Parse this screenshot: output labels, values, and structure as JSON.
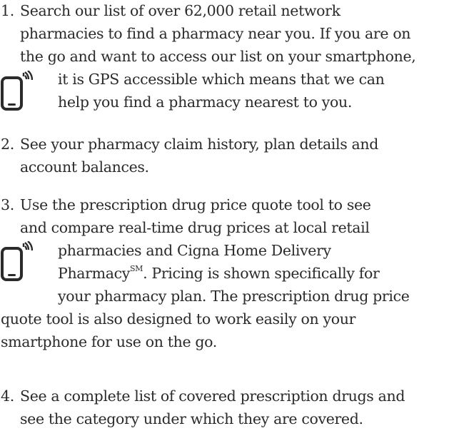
{
  "items": [
    {
      "number": "1.",
      "lines": [
        "Search our list of over 62,000 retail network",
        "pharmacies to find a pharmacy near you. If you are on",
        "the go and want to access our list on your smartphone,",
        "it is GPS accessible which means that we can",
        "help you find a pharmacy nearest to you."
      ]
    },
    {
      "number": "2.",
      "lines": [
        "See your pharmacy claim history, plan details and",
        "account balances."
      ]
    },
    {
      "number": "3.",
      "lines": [
        "Use the prescription drug price quote tool to see",
        "and compare real-time drug prices at local retail",
        "pharmacies and Cigna Home Delivery",
        "Pharmacy",
        ". Pricing is shown specifically for",
        "your pharmacy plan. The prescription drug price",
        "quote tool is also designed to work easily on your",
        "smartphone for use on the go."
      ],
      "superscript": "SM"
    },
    {
      "number": "4.",
      "lines": [
        "See a complete list of covered prescription drugs and",
        "see the category under which they are covered."
      ]
    }
  ],
  "icons": {
    "smartphone": "smartphone-gps-icon"
  }
}
